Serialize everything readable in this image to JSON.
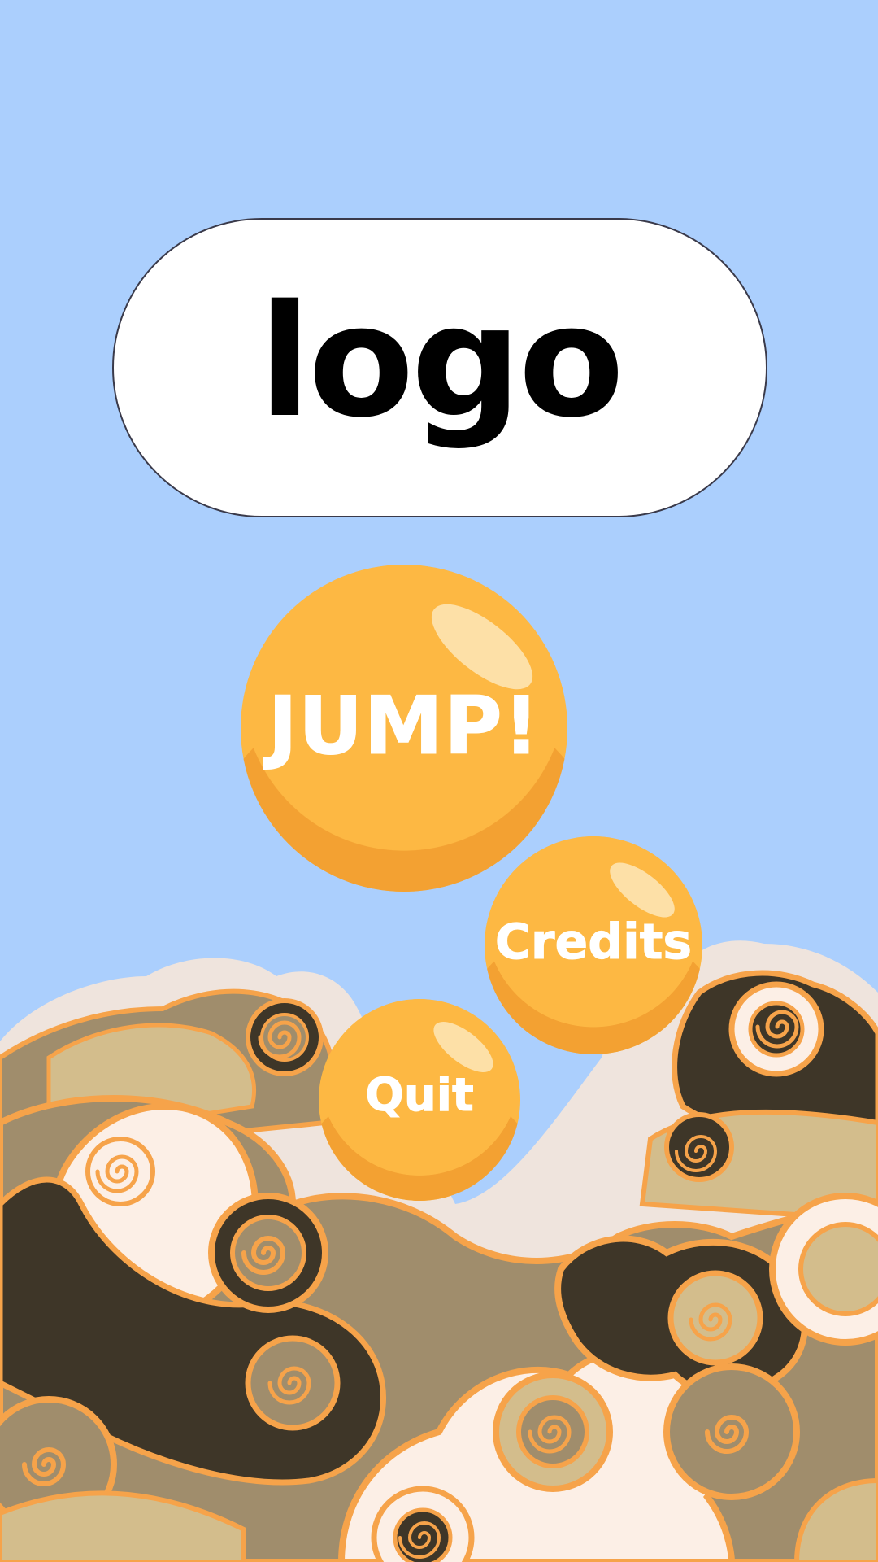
{
  "logo": {
    "text": "logo"
  },
  "menu": {
    "jump_label": "JUMP!",
    "credits_label": "Credits",
    "quit_label": "Quit"
  },
  "colors": {
    "sky": "#abcffd",
    "button": "#fdb843",
    "button_shade": "#f3a132",
    "button_highlight": "#fde1ad",
    "cloud_outline": "#f6a34a",
    "cloud_cream": "#fcefe6",
    "cloud_tan": "#d3bd8c",
    "cloud_taupe": "#a08d6c",
    "cloud_dark": "#3e3628",
    "cloud_halo": "#efe4dd"
  }
}
